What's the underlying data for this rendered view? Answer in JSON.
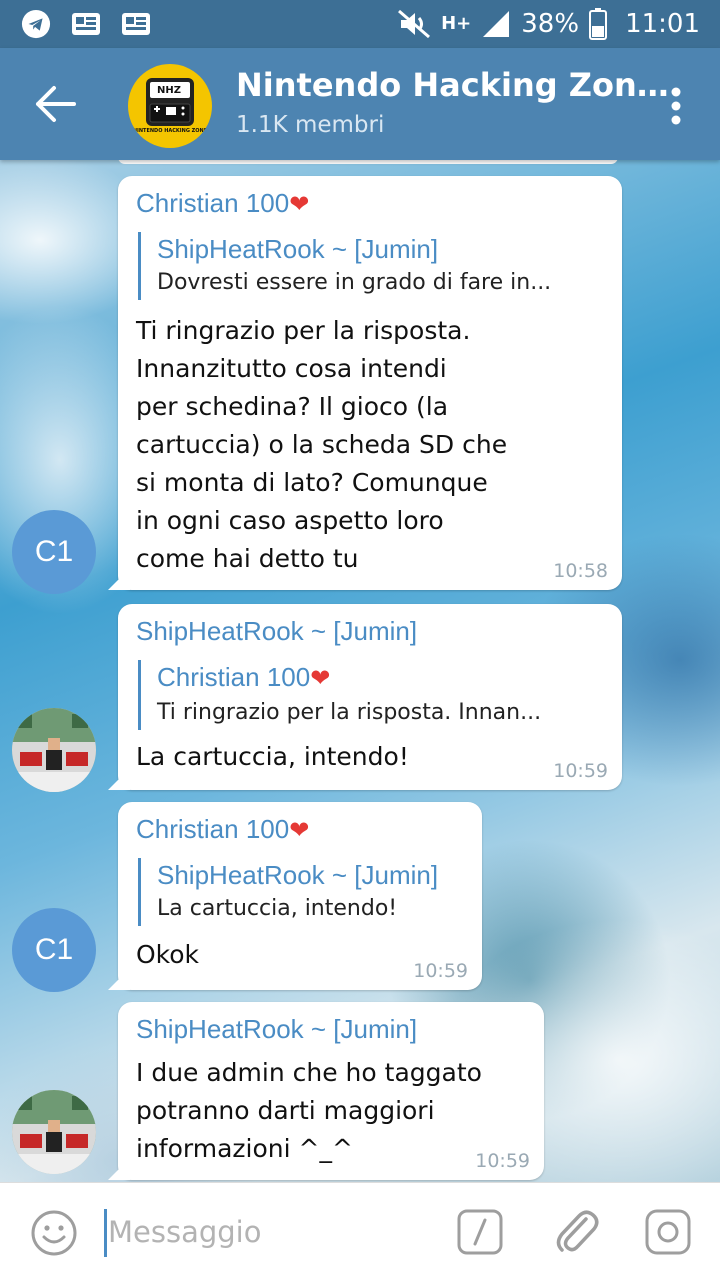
{
  "status_bar": {
    "network_label": "H+",
    "battery_percent": "38%",
    "time": "11:01",
    "icons": [
      "telegram-icon",
      "news-icon",
      "news-icon",
      "mute-icon",
      "signal-icon",
      "battery-icon"
    ]
  },
  "header": {
    "title": "Nintendo Hacking Zon…",
    "subtitle": "1.1K membri",
    "avatar_text": "NHZ",
    "avatar_caption": "NINTENDO HACKING ZONE"
  },
  "messages": [
    {
      "sender": "Christian 100",
      "sender_heart": "❤",
      "reply_name": "ShipHeatRook ~ [Jumin]",
      "reply_text": "Dovresti essere in grado di fare in...",
      "text": "Ti ringrazio per la risposta.\nInnanzitutto cosa intendi\nper schedina? Il gioco (la\ncartuccia) o la scheda SD che\nsi monta di lato? Comunque\nin ogni caso aspetto loro\ncome hai detto tu",
      "time": "10:58",
      "avatar": "C1"
    },
    {
      "sender": "ShipHeatRook ~ [Jumin]",
      "reply_name": "Christian 100",
      "reply_heart": "❤",
      "reply_text": "Ti ringrazio per la risposta. Innan...",
      "text": "La cartuccia, intendo!",
      "time": "10:59"
    },
    {
      "sender": "Christian 100",
      "sender_heart": "❤",
      "reply_name": "ShipHeatRook ~ [Jumin]",
      "reply_text": "La cartuccia, intendo!",
      "text": "Okok",
      "time": "10:59",
      "avatar": "C1"
    },
    {
      "sender": "ShipHeatRook ~ [Jumin]",
      "text": "I due admin che ho taggato\npotranno darti maggiori\ninformazioni ^_^",
      "time": "10:59"
    }
  ],
  "input": {
    "placeholder": "Messaggio"
  },
  "colors": {
    "header": "#4d84b1",
    "status_bar": "#3d6f95",
    "accent": "#4a8cc4",
    "avatar_c1": "#5a9ad6"
  }
}
